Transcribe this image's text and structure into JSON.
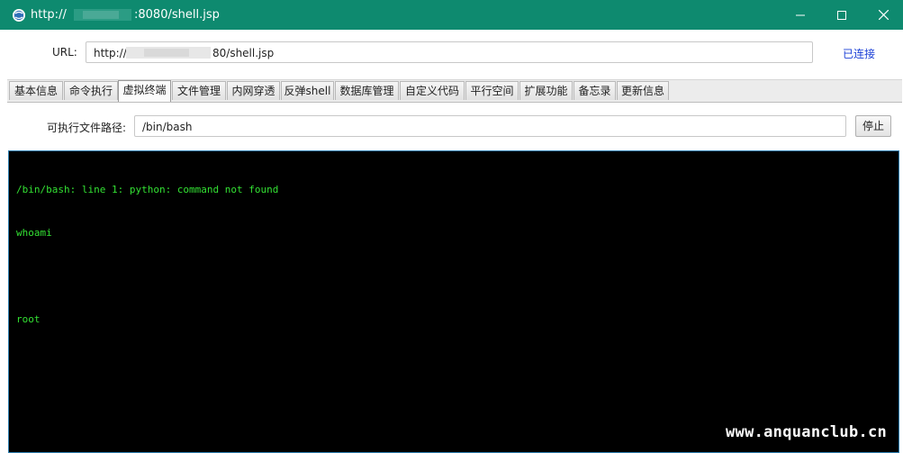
{
  "window": {
    "title_prefix": "http://",
    "title_suffix": ":8080/shell.jsp",
    "icons": [
      "app-globe-icon",
      "minimize-icon",
      "maximize-icon",
      "close-icon"
    ]
  },
  "url_bar": {
    "label": "URL:",
    "value_prefix": "http://",
    "value_suffix": "80/shell.jsp",
    "status": "已连接"
  },
  "tabs": [
    {
      "label": "基本信息",
      "active": false
    },
    {
      "label": "命令执行",
      "active": false
    },
    {
      "label": "虚拟终端",
      "active": true
    },
    {
      "label": "文件管理",
      "active": false
    },
    {
      "label": "内网穿透",
      "active": false
    },
    {
      "label": "反弹shell",
      "active": false
    },
    {
      "label": "数据库管理",
      "active": false
    },
    {
      "label": "自定义代码",
      "active": false
    },
    {
      "label": "平行空间",
      "active": false
    },
    {
      "label": "扩展功能",
      "active": false
    },
    {
      "label": "备忘录",
      "active": false
    },
    {
      "label": "更新信息",
      "active": false
    }
  ],
  "terminal_panel": {
    "path_label": "可执行文件路径:",
    "path_value": "/bin/bash",
    "stop_label": "停止",
    "lines": [
      "/bin/bash: line 1: python: command not found",
      "whoami",
      "",
      "root"
    ]
  },
  "watermark": "www.anquanclub.cn",
  "colors": {
    "titlebar": "#0e8a6f",
    "terminal_bg": "#000000",
    "terminal_text": "#33e033",
    "status_link": "#1a3fd6"
  }
}
